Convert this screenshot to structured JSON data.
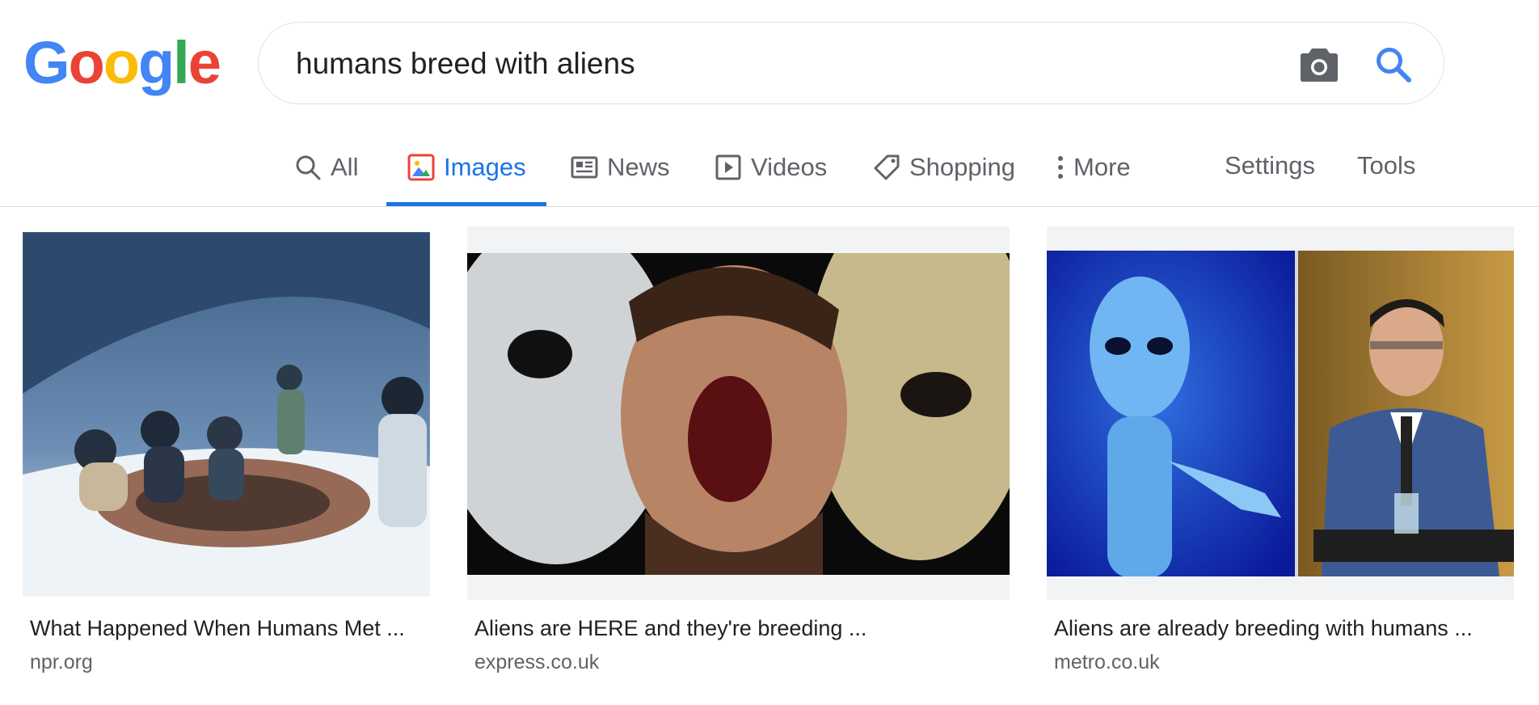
{
  "logo": {
    "letters": [
      "G",
      "o",
      "o",
      "g",
      "l",
      "e"
    ],
    "colors": [
      "#4285f4",
      "#ea4335",
      "#fbbc05",
      "#4285f4",
      "#34a853",
      "#ea4335"
    ]
  },
  "search": {
    "query": "humans breed with aliens"
  },
  "tabs": [
    {
      "label": "All",
      "icon": "search-icon",
      "active": false
    },
    {
      "label": "Images",
      "icon": "image-icon",
      "active": true
    },
    {
      "label": "News",
      "icon": "news-icon",
      "active": false
    },
    {
      "label": "Videos",
      "icon": "video-icon",
      "active": false
    },
    {
      "label": "Shopping",
      "icon": "tag-icon",
      "active": false
    },
    {
      "label": "More",
      "icon": "more-vert-icon",
      "active": false
    }
  ],
  "tools": {
    "settings": "Settings",
    "tools": "Tools"
  },
  "results": [
    {
      "title": "What Happened When Humans Met ...",
      "source": "npr.org"
    },
    {
      "title": "Aliens are HERE and they're breeding ...",
      "source": "express.co.uk"
    },
    {
      "title": "Aliens are already breeding with humans ...",
      "source": "metro.co.uk"
    }
  ],
  "colors": {
    "accent": "#1a73e8",
    "text": "#202124",
    "muted": "#5f6368",
    "border": "#dfe1e5"
  }
}
